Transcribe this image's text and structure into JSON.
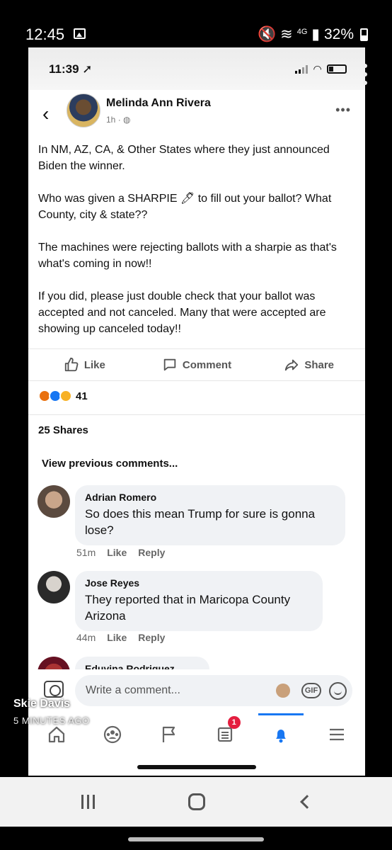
{
  "outer_status": {
    "time": "12:45",
    "network": "4G",
    "battery": "32%"
  },
  "inner_status": {
    "time": "11:39"
  },
  "post": {
    "author": "Melinda Ann Rivera",
    "meta": "1h",
    "paragraphs": [
      "In NM, AZ, CA, & Other States where they just announced Biden the winner.",
      "Who was given a SHARPIE 🖊 to fill out your ballot? What County, city & state??",
      "The machines were rejecting ballots with a sharpie as that's what's coming in now!!",
      "If you did,  please just double check that your ballot was accepted and not canceled.  Many that were accepted are showing up canceled today!!"
    ],
    "actions": {
      "like": "Like",
      "comment": "Comment",
      "share": "Share"
    },
    "reaction_count": "41",
    "shares": "25 Shares",
    "view_previous": "View previous comments..."
  },
  "comments": [
    {
      "name": "Adrian Romero",
      "text": "So does this mean Trump for sure is gonna lose?",
      "time": "51m",
      "like": "Like",
      "reply": "Reply"
    },
    {
      "name": "Jose Reyes",
      "text": "They reported that in Maricopa County Arizona",
      "time": "44m",
      "like": "Like",
      "reply": "Reply"
    },
    {
      "name": "Eduvina Rodriquez"
    }
  ],
  "composer": {
    "placeholder": "Write a comment...",
    "gif": "GIF"
  },
  "nav": {
    "notifications_badge": "1"
  },
  "story_overlay": {
    "name": "Skie Davis",
    "time": "5 MINUTES AGO"
  },
  "colors": {
    "facebook_blue": "#1877f2",
    "badge_red": "#e41e3f"
  }
}
